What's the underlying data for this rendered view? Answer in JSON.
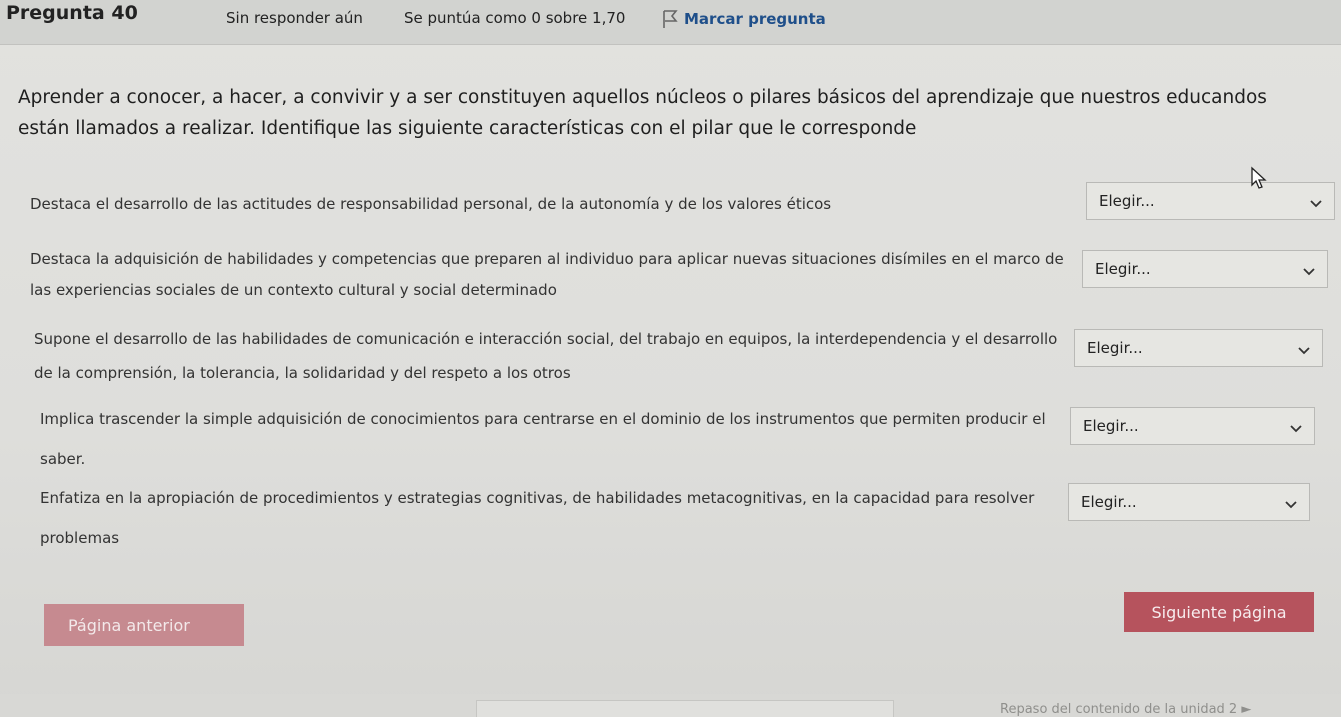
{
  "header": {
    "question_number": "Pregunta 40",
    "state": "Sin responder aún",
    "grade": "Se puntúa como 0 sobre 1,70",
    "flag_label": "Marcar pregunta"
  },
  "question": {
    "text": "Aprender a conocer, a hacer, a convivir y a ser constituyen aquellos núcleos o pilares básicos del aprendizaje que nuestros educandos están llamados a realizar. Identifique las siguiente características con el pilar que le corresponde"
  },
  "rows": [
    {
      "text": "Destaca el desarrollo de las actitudes de responsabilidad personal, de la autonomía y de los valores éticos",
      "selected": "Elegir..."
    },
    {
      "text": "Destaca la adquisición de habilidades y competencias que preparen al individuo para aplicar nuevas situaciones disímiles en el marco de las experiencias sociales de un contexto cultural y social determinado",
      "selected": "Elegir..."
    },
    {
      "text": "Supone el desarrollo de las habilidades de comunicación e interacción social, del trabajo en equipos, la interdependencia y el desarrollo de la comprensión, la tolerancia, la solidaridad y del respeto a los otros",
      "selected": "Elegir..."
    },
    {
      "text": "Implica trascender la simple adquisición de conocimientos para centrarse en el dominio de los instrumentos que permiten producir el saber.",
      "selected": "Elegir..."
    },
    {
      "text": "Enfatiza en la apropiación de procedimientos y estrategias cognitivas, de habilidades metacognitivas, en la capacidad para resolver problemas",
      "selected": "Elegir..."
    }
  ],
  "nav": {
    "prev_label": "Página anterior",
    "next_label": "Siguiente página"
  },
  "footer": {
    "link_text": "Repaso del contenido de la unidad 2 ►"
  },
  "colors": {
    "accent": "#b6535d",
    "flag": "#1f4f8a"
  }
}
